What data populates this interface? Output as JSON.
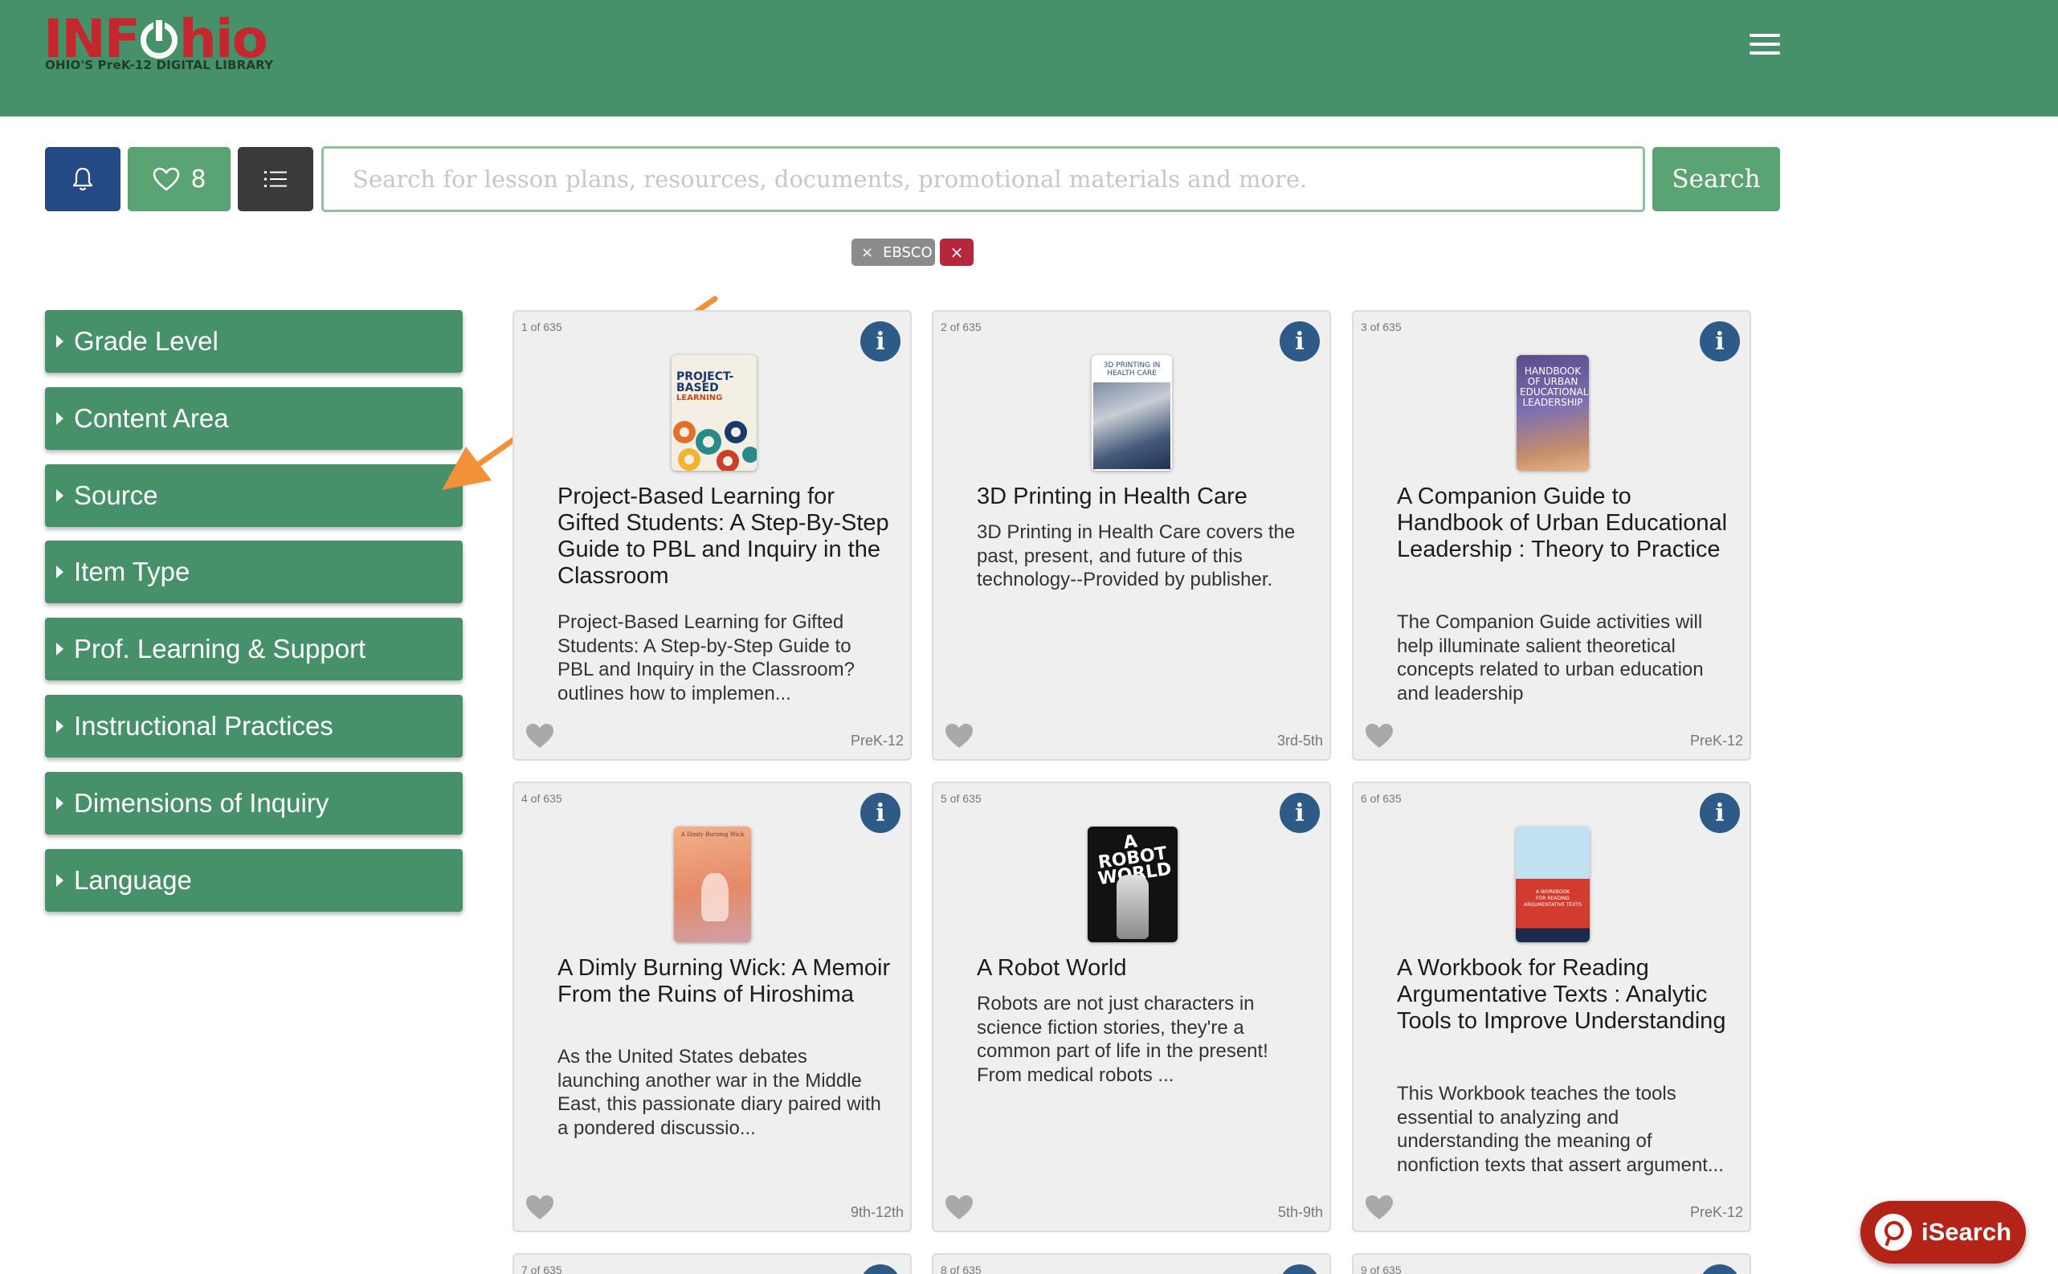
{
  "header": {
    "logo_main_a": "INF",
    "logo_main_b": "hio",
    "logo_sub": "OHIO'S PreK-12 DIGITAL LIBRARY"
  },
  "toolbar": {
    "favorites_count": "8",
    "search_placeholder": "Search for lesson plans, resources, documents, promotional materials and more.",
    "search_label": "Search"
  },
  "filters": {
    "active": [
      {
        "label": "EBSCO"
      }
    ],
    "clear_symbol": "×",
    "remove_symbol": "×"
  },
  "sidebar": {
    "facets": [
      {
        "label": "Grade Level"
      },
      {
        "label": "Content Area"
      },
      {
        "label": "Source"
      },
      {
        "label": "Item Type"
      },
      {
        "label": "Prof. Learning & Support"
      },
      {
        "label": "Instructional Practices"
      },
      {
        "label": "Dimensions of Inquiry"
      },
      {
        "label": "Language"
      }
    ]
  },
  "results": {
    "cards": [
      {
        "counter": "1 of 635",
        "title": "Project-Based Learning for Gifted Students: A Step-By-Step Guide to PBL and Inquiry in the Classroom",
        "description": "Project-Based Learning for Gifted Students: A Step-by-Step Guide to PBL and Inquiry in the Classroom?outlines how to implemen...",
        "grade": "PreK-12",
        "cover": {
          "line1": "PROJECT-",
          "line2": "BASED",
          "line3": "LEARNING"
        }
      },
      {
        "counter": "2 of 635",
        "title": "3D Printing in Health Care",
        "description": "3D Printing in Health Care covers the past, present, and future of this technology--Provided by publisher.",
        "grade": "3rd-5th",
        "cover": {
          "line1": "3D PRINTING IN",
          "line2": "HEALTH CARE"
        }
      },
      {
        "counter": "3 of 635",
        "title": "A Companion Guide to Handbook of Urban Educational Leadership : Theory to Practice",
        "description": "The Companion Guide activities will help illuminate salient theoretical concepts related to urban education and leadership",
        "grade": "PreK-12",
        "cover": {
          "line1": "HANDBOOK",
          "line2": "OF URBAN",
          "line3": "EDUCATIONAL",
          "line4": "LEADERSHIP"
        }
      },
      {
        "counter": "4 of 635",
        "title": "A Dimly Burning Wick: A Memoir From the Ruins of Hiroshima",
        "description": "As the United States debates launching another war in the Middle East, this passionate diary paired with a pondered discussio...",
        "grade": "9th-12th",
        "cover": {
          "line1": "A Dimly Burning Wick"
        }
      },
      {
        "counter": "5 of 635",
        "title": "A Robot World",
        "description": "Robots are not just characters in science fiction stories, they're a common part of life in the present! From medical robots ...",
        "grade": "5th-9th",
        "cover": {
          "line1": "A ROBOT",
          "line2": "WORLD"
        }
      },
      {
        "counter": "6 of 635",
        "title": "A Workbook for Reading Argumentative Texts : Analytic Tools to Improve Understanding",
        "description": "This Workbook teaches the tools essential to analyzing and understanding the meaning of nonfiction texts that assert argument...",
        "grade": "PreK-12",
        "cover": {
          "line1": "A WORKBOOK",
          "line2": "FOR READING",
          "line3": "ARGUMENTATIVE TEXTS"
        }
      }
    ],
    "partial_cards": [
      {
        "counter": "7 of 635"
      },
      {
        "counter": "8 of 635"
      },
      {
        "counter": "9 of 635"
      }
    ],
    "info_glyph": "i"
  },
  "isearch": {
    "label": "iSearch"
  },
  "colors": {
    "header_green": "#47916a",
    "button_green": "#5aa373",
    "bell_blue": "#234a82",
    "list_dark": "#3a3a3a",
    "info_blue": "#2d5a86",
    "chip_red": "#b5283b",
    "arrow_orange": "#f2913a",
    "isearch_red": "#b42318"
  }
}
